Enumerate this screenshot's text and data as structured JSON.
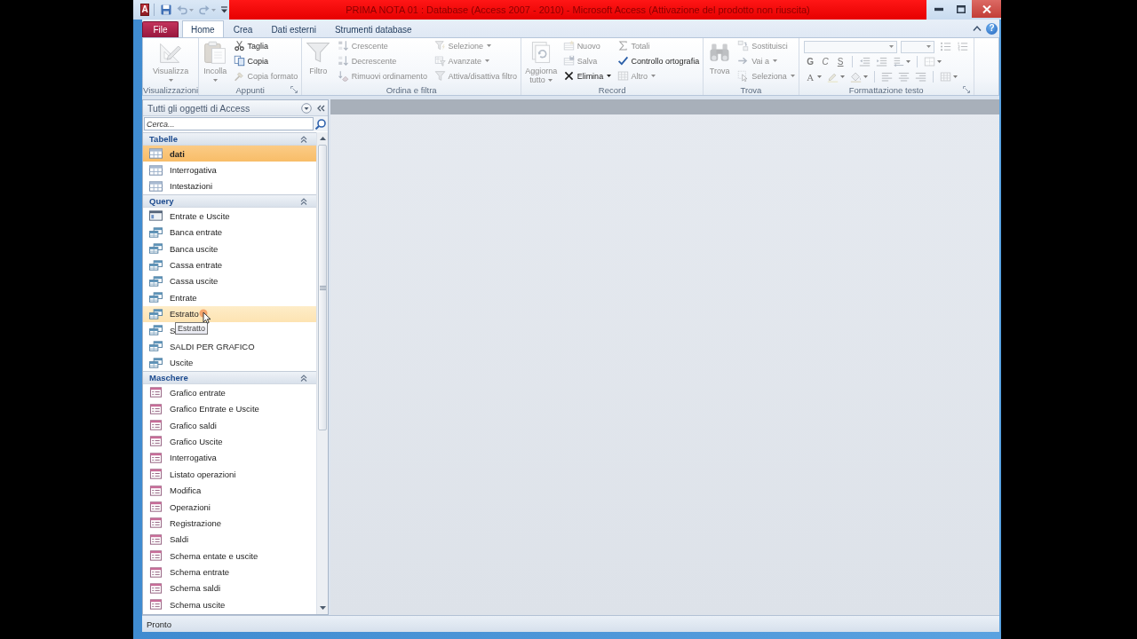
{
  "window": {
    "app_icon": "A",
    "title": "PRIMA NOTA 01 : Database (Access 2007 - 2010) - Microsoft Access (Attivazione del prodotto non riuscita)"
  },
  "quick_access": [
    {
      "kind": "save",
      "disabled": false
    },
    {
      "kind": "undo",
      "disabled": true
    },
    {
      "kind": "redo",
      "disabled": true
    },
    {
      "kind": "customize",
      "disabled": false
    }
  ],
  "tabs": [
    {
      "label": "File",
      "kind": "backstage",
      "selected": false
    },
    {
      "label": "Home",
      "kind": "tab",
      "selected": true
    },
    {
      "label": "Crea",
      "kind": "tab",
      "selected": false
    },
    {
      "label": "Dati esterni",
      "kind": "tab",
      "selected": false
    },
    {
      "label": "Strumenti database",
      "kind": "tab",
      "selected": false
    }
  ],
  "help_button": {
    "label": "?"
  },
  "ribbon": {
    "groups": [
      {
        "kind": "standard",
        "label": "Visualizzazioni",
        "launcher": false,
        "columns": [
          {
            "kind": "large",
            "label": "Visualizza",
            "dropdown": true,
            "disabled": true
          }
        ]
      },
      {
        "kind": "standard",
        "label": "Appunti",
        "launcher": true,
        "columns": [
          {
            "kind": "large",
            "label": "Incolla",
            "dropdown": true,
            "disabled": true
          },
          {
            "kind": "stack",
            "items": [
              {
                "label": "Taglia",
                "dropdown": false,
                "disabled": false
              },
              {
                "label": "Copia",
                "dropdown": false,
                "disabled": false
              },
              {
                "label": "Copia formato",
                "dropdown": false,
                "disabled": true
              }
            ]
          }
        ]
      },
      {
        "kind": "standard",
        "label": "Ordina e filtra",
        "launcher": false,
        "columns": [
          {
            "kind": "large",
            "label": "Filtro",
            "dropdown": false,
            "disabled": true
          },
          {
            "kind": "stack",
            "items": [
              {
                "label": "Crescente",
                "dropdown": false,
                "disabled": true
              },
              {
                "label": "Decrescente",
                "dropdown": false,
                "disabled": true
              },
              {
                "label": "Rimuovi ordinamento",
                "dropdown": false,
                "disabled": true
              }
            ]
          },
          {
            "kind": "stack",
            "items": [
              {
                "label": "Selezione",
                "dropdown": true,
                "disabled": true
              },
              {
                "label": "Avanzate",
                "dropdown": true,
                "disabled": true
              },
              {
                "label": "Attiva/disattiva filtro",
                "dropdown": false,
                "disabled": true
              }
            ]
          }
        ]
      },
      {
        "kind": "standard",
        "label": "Record",
        "launcher": false,
        "columns": [
          {
            "kind": "large",
            "label": "Aggiorna tutto",
            "dropdown": true,
            "disabled": true
          },
          {
            "kind": "stack",
            "items": [
              {
                "label": "Nuovo",
                "dropdown": false,
                "disabled": true
              },
              {
                "label": "Salva",
                "dropdown": false,
                "disabled": true
              },
              {
                "label": "Elimina",
                "dropdown": true,
                "disabled": false
              }
            ]
          },
          {
            "kind": "stack",
            "items": [
              {
                "label": "Totali",
                "dropdown": false,
                "disabled": true
              },
              {
                "label": "Controllo ortografia",
                "dropdown": false,
                "disabled": false
              },
              {
                "label": "Altro",
                "dropdown": true,
                "disabled": true
              }
            ]
          }
        ]
      },
      {
        "kind": "standard",
        "label": "Trova",
        "launcher": false,
        "columns": [
          {
            "kind": "large",
            "label": "Trova",
            "dropdown": false,
            "disabled": true
          },
          {
            "kind": "stack",
            "items": [
              {
                "label": "Sostituisci",
                "dropdown": false,
                "disabled": true
              },
              {
                "label": "Vai a",
                "dropdown": true,
                "disabled": true
              },
              {
                "label": "Seleziona",
                "dropdown": true,
                "disabled": true
              }
            ]
          }
        ]
      },
      {
        "kind": "format",
        "label": "Formattazione testo",
        "launcher": true,
        "fields": [
          {
            "disabled": true
          },
          {
            "disabled": true
          }
        ],
        "rows": [
          [
            [
              {
                "kind": "icon",
                "dropdown": false,
                "disabled": true
              },
              {
                "kind": "icon",
                "dropdown": false,
                "disabled": true
              }
            ]
          ],
          [
            [
              {
                "kind": "text",
                "label": "G",
                "dropdown": false,
                "disabled": true
              },
              {
                "kind": "text",
                "label": "C",
                "dropdown": false,
                "disabled": true
              },
              {
                "kind": "text",
                "label": "S",
                "dropdown": false,
                "disabled": true
              }
            ],
            [
              {
                "kind": "icon",
                "dropdown": false,
                "disabled": true
              },
              {
                "kind": "icon",
                "dropdown": false,
                "disabled": true
              },
              {
                "kind": "icon",
                "dropdown": true,
                "disabled": true
              }
            ],
            [
              {
                "kind": "icon",
                "dropdown": true,
                "disabled": true
              }
            ]
          ],
          [
            [
              {
                "kind": "text",
                "label": "A",
                "dropdown": true,
                "disabled": true
              },
              {
                "kind": "icon",
                "dropdown": true,
                "disabled": true
              },
              {
                "kind": "icon",
                "dropdown": true,
                "disabled": true
              }
            ],
            [
              {
                "kind": "icon",
                "dropdown": false,
                "disabled": true
              },
              {
                "kind": "icon",
                "dropdown": false,
                "disabled": true
              },
              {
                "kind": "icon",
                "dropdown": false,
                "disabled": true
              }
            ],
            [
              {
                "kind": "icon",
                "dropdown": true,
                "disabled": true
              }
            ]
          ]
        ]
      }
    ]
  },
  "navigation_pane": {
    "title": "Tutti gli oggetti di Access",
    "search": {
      "placeholder": "Cerca..."
    },
    "groups": [
      {
        "label": "Tabelle",
        "expanded": true,
        "items": [
          {
            "label": "dati",
            "kind": "table",
            "selected": true,
            "hovered": false
          },
          {
            "label": "Interrogativa",
            "kind": "table",
            "selected": false,
            "hovered": false
          },
          {
            "label": "Intestazioni",
            "kind": "table",
            "selected": false,
            "hovered": false
          }
        ]
      },
      {
        "label": "Query",
        "expanded": true,
        "items": [
          {
            "label": "Entrate e Uscite",
            "kind": "union",
            "selected": false,
            "hovered": false
          },
          {
            "label": "Banca entrate",
            "kind": "query",
            "selected": false,
            "hovered": false
          },
          {
            "label": "Banca uscite",
            "kind": "query",
            "selected": false,
            "hovered": false
          },
          {
            "label": "Cassa entrate",
            "kind": "query",
            "selected": false,
            "hovered": false
          },
          {
            "label": "Cassa uscite",
            "kind": "query",
            "selected": false,
            "hovered": false
          },
          {
            "label": "Entrate",
            "kind": "query",
            "selected": false,
            "hovered": false
          },
          {
            "label": "Estratto",
            "kind": "query",
            "selected": false,
            "hovered": true,
            "tooltip": "Estratto"
          },
          {
            "label": "S",
            "kind": "query",
            "selected": false,
            "hovered": false
          },
          {
            "label": "SALDI PER GRAFICO",
            "kind": "query",
            "selected": false,
            "hovered": false
          },
          {
            "label": "Uscite",
            "kind": "query",
            "selected": false,
            "hovered": false
          }
        ]
      },
      {
        "label": "Maschere",
        "expanded": true,
        "items": [
          {
            "label": "Grafico entrate",
            "kind": "form",
            "selected": false,
            "hovered": false
          },
          {
            "label": "Grafico Entrate e Uscite",
            "kind": "form",
            "selected": false,
            "hovered": false
          },
          {
            "label": "Grafico saldi",
            "kind": "form",
            "selected": false,
            "hovered": false
          },
          {
            "label": "Grafico Uscite",
            "kind": "form",
            "selected": false,
            "hovered": false
          },
          {
            "label": "Interrogativa",
            "kind": "form",
            "selected": false,
            "hovered": false
          },
          {
            "label": "Listato operazioni",
            "kind": "form",
            "selected": false,
            "hovered": false
          },
          {
            "label": "Modifica",
            "kind": "form",
            "selected": false,
            "hovered": false
          },
          {
            "label": "Operazioni",
            "kind": "form",
            "selected": false,
            "hovered": false
          },
          {
            "label": "Registrazione",
            "kind": "form",
            "selected": false,
            "hovered": false
          },
          {
            "label": "Saldi",
            "kind": "form",
            "selected": false,
            "hovered": false
          },
          {
            "label": "Schema entate e uscite",
            "kind": "form",
            "selected": false,
            "hovered": false
          },
          {
            "label": "Schema entrate",
            "kind": "form",
            "selected": false,
            "hovered": false
          },
          {
            "label": "Schema saldi",
            "kind": "form",
            "selected": false,
            "hovered": false
          },
          {
            "label": "Schema uscite",
            "kind": "form",
            "selected": false,
            "hovered": false
          }
        ]
      }
    ]
  },
  "status_bar": {
    "text": "Pronto"
  }
}
